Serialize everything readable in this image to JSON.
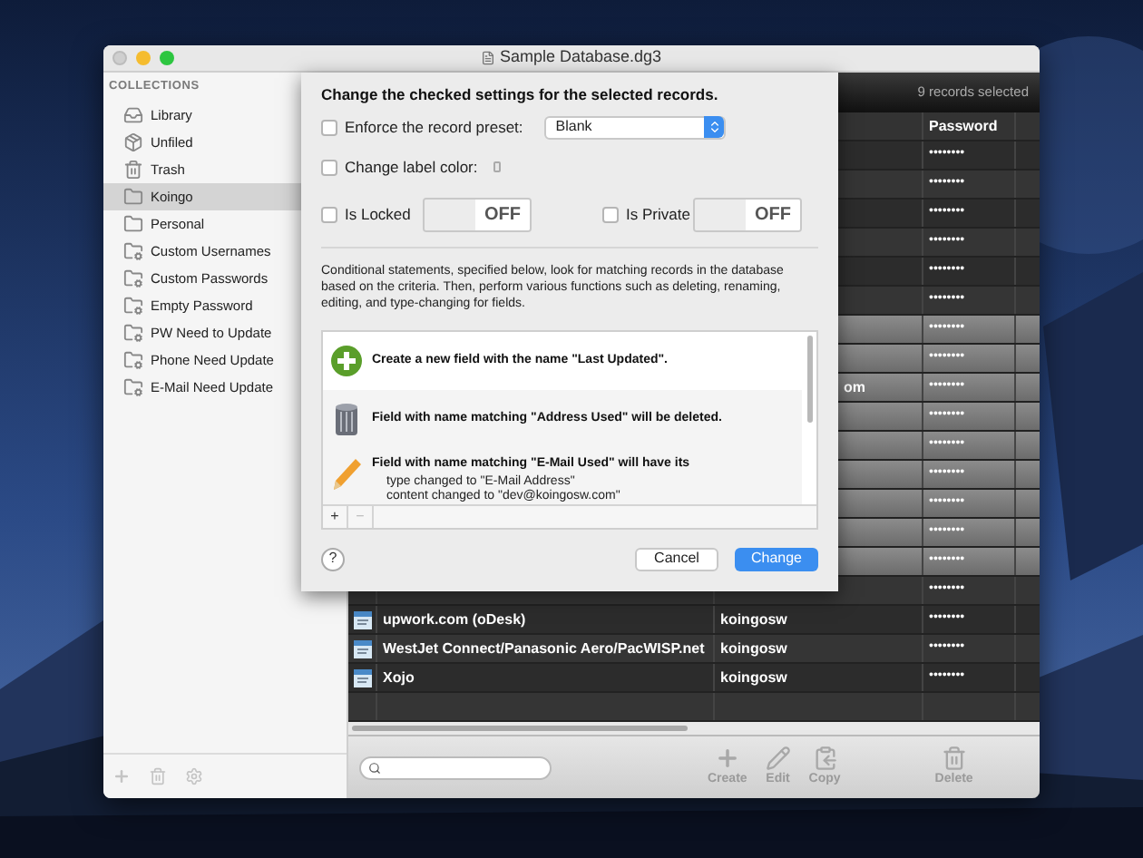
{
  "window": {
    "title": "Sample Database.dg3"
  },
  "sidebar": {
    "heading": "COLLECTIONS",
    "items": [
      {
        "label": "Library",
        "kind": "library",
        "selected": false
      },
      {
        "label": "Unfiled",
        "kind": "unfiled",
        "selected": false
      },
      {
        "label": "Trash",
        "kind": "trash",
        "selected": false
      },
      {
        "label": "Koingo",
        "kind": "folder",
        "selected": true
      },
      {
        "label": "Personal",
        "kind": "folder",
        "selected": false
      },
      {
        "label": "Custom Usernames",
        "kind": "smart",
        "selected": false
      },
      {
        "label": "Custom Passwords",
        "kind": "smart",
        "selected": false
      },
      {
        "label": "Empty Password",
        "kind": "smart",
        "selected": false
      },
      {
        "label": "PW Need to Update",
        "kind": "smart",
        "selected": false
      },
      {
        "label": "Phone Need Update",
        "kind": "smart",
        "selected": false
      },
      {
        "label": "E-Mail Need Update",
        "kind": "smart",
        "selected": false
      }
    ]
  },
  "header": {
    "status": "9 records selected"
  },
  "table": {
    "columns": [
      {
        "label": "Password"
      }
    ],
    "rows": [
      {
        "selected": false,
        "password": "••••••••"
      },
      {
        "selected": false,
        "password": "••••••••"
      },
      {
        "selected": false,
        "password": "••••••••"
      },
      {
        "selected": false,
        "password": "••••••••"
      },
      {
        "selected": false,
        "password": "••••••••"
      },
      {
        "selected": false,
        "password": "••••••••"
      },
      {
        "selected": true,
        "password": "••••••••"
      },
      {
        "selected": true,
        "password": "••••••••"
      },
      {
        "selected": true,
        "username": "om",
        "password": "••••••••"
      },
      {
        "selected": true,
        "password": "••••••••"
      },
      {
        "selected": true,
        "password": "••••••••"
      },
      {
        "selected": true,
        "password": "••••••••"
      },
      {
        "selected": true,
        "password": "••••••••"
      },
      {
        "selected": true,
        "password": "••••••••"
      },
      {
        "selected": true,
        "password": "••••••••"
      },
      {
        "selected": false,
        "password": "••••••••"
      },
      {
        "selected": false,
        "name": "upwork.com (oDesk)",
        "username": "koingosw",
        "password": "••••••••"
      },
      {
        "selected": false,
        "name": "WestJet Connect/Panasonic Aero/PacWISP.net",
        "username": "koingosw",
        "password": "••••••••"
      },
      {
        "selected": false,
        "name": "Xojo",
        "username": "koingosw",
        "password": "••••••••"
      },
      {
        "selected": false
      }
    ]
  },
  "toolbar": {
    "tools": [
      {
        "label": "Create",
        "kind": "create",
        "disabled": true
      },
      {
        "label": "Edit",
        "kind": "edit",
        "disabled": true
      },
      {
        "label": "Copy",
        "kind": "copy",
        "disabled": true
      },
      {
        "label": "Delete",
        "kind": "delete",
        "disabled": true
      }
    ]
  },
  "sheet": {
    "heading": "Change the checked settings for the selected records.",
    "enforce_preset": {
      "label": "Enforce the record preset:",
      "checked": false,
      "value": "Blank"
    },
    "label_color": {
      "label": "Change label color:",
      "checked": false
    },
    "locked": {
      "label": "Is Locked",
      "checked": false,
      "on": false,
      "toggle": "OFF"
    },
    "private": {
      "label": "Is Private",
      "checked": false,
      "on": false,
      "toggle": "OFF"
    },
    "description": "Conditional statements, specified below, look for matching records in the database based on the criteria. Then, perform various functions such as deleting, renaming, editing, and type-changing for fields.",
    "actions": [
      {
        "kind": "create",
        "text": "Create a new field with the name \"Last Updated\"."
      },
      {
        "kind": "delete",
        "text": "Field with name matching \"Address Used\" will be deleted."
      },
      {
        "kind": "edit",
        "text": "Field with name matching \"E-Mail Used\" will have its",
        "details": [
          "type changed to \"E-Mail Address\"",
          "content changed to \"dev@koingosw.com\""
        ]
      }
    ],
    "list_buttons": [
      {
        "label": "+",
        "disabled": false
      },
      {
        "label": "−",
        "disabled": true
      }
    ],
    "help": "?",
    "buttons": [
      {
        "label": "Cancel",
        "default": false
      },
      {
        "label": "Change",
        "default": true
      }
    ]
  }
}
